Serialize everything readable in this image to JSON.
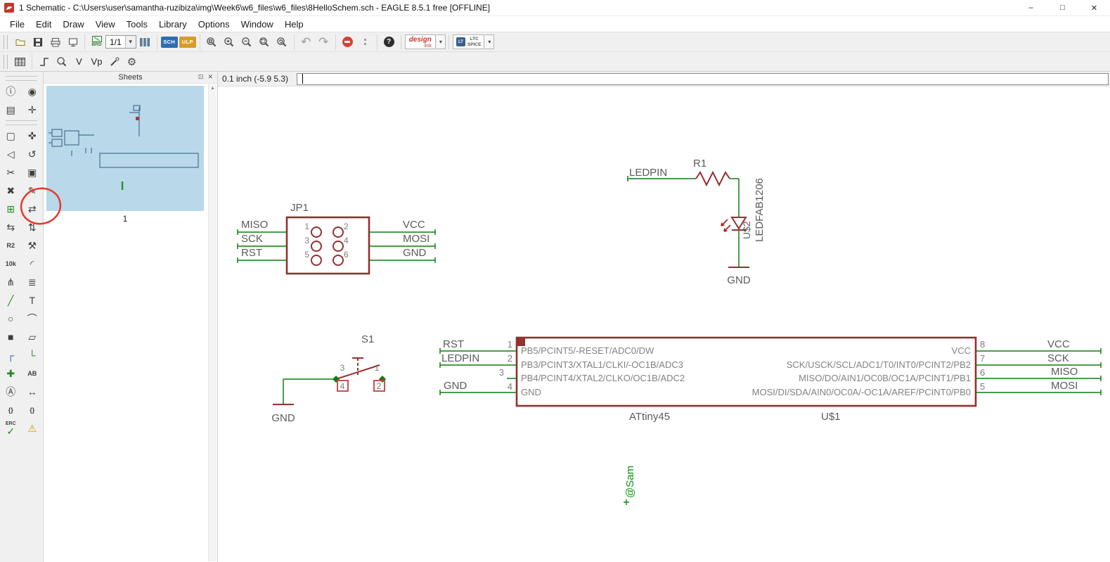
{
  "window": {
    "title": "1 Schematic - C:\\Users\\user\\samantha-ruzibiza\\img\\Week6\\w6_files\\w6_files\\8HelloSchem.sch - EAGLE 8.5.1 free [OFFLINE]",
    "minimize": "–",
    "maximize": "□",
    "close": "✕"
  },
  "menu": {
    "items": [
      "File",
      "Edit",
      "Draw",
      "View",
      "Tools",
      "Library",
      "Options",
      "Window",
      "Help"
    ]
  },
  "toolbar1": {
    "icons": [
      "open",
      "save",
      "print",
      "export-image",
      "switch-to-board",
      "sheet-selector",
      "sheets-list",
      "run-script",
      "run-ulp",
      "zoom-fit",
      "zoom-in",
      "zoom-out",
      "zoom-select",
      "zoom-redraw",
      "undo",
      "redo",
      "stop",
      "command-menu",
      "help",
      "design-link",
      "ltc-spice"
    ],
    "sheet_selector": "1/1",
    "brd_label": "BRD",
    "sch_label": "SCH",
    "ulp_label": "ULP",
    "undo_glyph": "↶",
    "redo_glyph": "↷",
    "help_glyph": "?",
    "dropdown_arrow": "▾",
    "design_link_line1": "design",
    "design_link_line2": "link",
    "ltc_line1": "LTC",
    "ltc_line2": "SPICE",
    "ltc_logo": "LT"
  },
  "toolbar2": {
    "icons": [
      "grid",
      "wire-bend",
      "zoom",
      "voltage-probe",
      "phase-probe",
      "probe",
      "spice-settings"
    ],
    "v_label": "V",
    "vp_label": "Vp",
    "gear_glyph": "⚙"
  },
  "sheets_panel": {
    "title": "Sheets",
    "sheet_number": "1",
    "float_button": "⊡",
    "close_button": "✕",
    "scroll_up": "▲"
  },
  "statusbar": {
    "coordinates": "0.1 inch (-5.9 5.3)"
  },
  "palette": {
    "tools": [
      {
        "name": "info",
        "glyph": "ⓘ"
      },
      {
        "name": "show",
        "glyph": "◉"
      },
      {
        "name": "display-layers",
        "glyph": "▤"
      },
      {
        "name": "mark",
        "glyph": "✛"
      },
      {
        "name": "group",
        "glyph": "▢"
      },
      {
        "name": "move",
        "glyph": "✜"
      },
      {
        "name": "mirror",
        "glyph": "◁"
      },
      {
        "name": "rotate",
        "glyph": "↺"
      },
      {
        "name": "cut",
        "glyph": "✂"
      },
      {
        "name": "copy",
        "glyph": "▣"
      },
      {
        "name": "delete",
        "glyph": "✖"
      },
      {
        "name": "change",
        "glyph": "✎"
      },
      {
        "name": "add-part",
        "glyph": "⊞",
        "cls": "g-green"
      },
      {
        "name": "pinswap",
        "glyph": "⇄"
      },
      {
        "name": "replace",
        "glyph": "⇆"
      },
      {
        "name": "gateswap",
        "glyph": "⇅"
      },
      {
        "name": "name",
        "glyph": "R2",
        "cls": "g-tiny"
      },
      {
        "name": "smash",
        "glyph": "⚒"
      },
      {
        "name": "value",
        "glyph": "10k",
        "cls": "g-tiny"
      },
      {
        "name": "miter",
        "glyph": "◜"
      },
      {
        "name": "split",
        "glyph": "⋔"
      },
      {
        "name": "invoke",
        "glyph": "≣"
      },
      {
        "name": "wire",
        "glyph": "╱",
        "cls": "g-green"
      },
      {
        "name": "text",
        "glyph": "T"
      },
      {
        "name": "circle",
        "glyph": "○"
      },
      {
        "name": "arc",
        "glyph": "⌒"
      },
      {
        "name": "rect",
        "glyph": "■"
      },
      {
        "name": "polygon",
        "glyph": "▱"
      },
      {
        "name": "bus",
        "glyph": "┌",
        "cls": "g-blue"
      },
      {
        "name": "net",
        "glyph": "└",
        "cls": "g-green"
      },
      {
        "name": "junction",
        "glyph": "✚",
        "cls": "g-green"
      },
      {
        "name": "label",
        "glyph": "AB",
        "cls": "g-tiny"
      },
      {
        "name": "attribute",
        "glyph": "Ⓐ"
      },
      {
        "name": "dimension",
        "glyph": "↔"
      },
      {
        "name": "attributes",
        "glyph": "{}",
        "cls": "g-tiny"
      },
      {
        "name": "global-attributes",
        "glyph": "{}",
        "cls": "g-tiny"
      },
      {
        "name": "erc",
        "glyph": "✓",
        "cls": "g-green",
        "top": "ERC"
      },
      {
        "name": "errors",
        "glyph": "⚠",
        "cls": "g-amber"
      }
    ]
  },
  "schematic": {
    "jp1": {
      "ref": "JP1",
      "pins": {
        "p1": "1",
        "p2": "2",
        "p3": "3",
        "p4": "4",
        "p5": "5",
        "p6": "6"
      },
      "nets": {
        "miso": "MISO",
        "sck": "SCK",
        "rst": "RST",
        "vcc": "VCC",
        "mosi": "MOSI",
        "gnd": "GND"
      }
    },
    "r1": {
      "ref": "R1",
      "net": "LEDPIN"
    },
    "led": {
      "ref": "U$2",
      "value": "LEDFAB1206",
      "gnd": "GND"
    },
    "s1": {
      "ref": "S1",
      "pins": {
        "p1": "1",
        "p2": "2",
        "p3": "3",
        "p4": "4"
      },
      "gnd": "GND"
    },
    "ic": {
      "ref": "U$1",
      "value": "ATtiny45",
      "left_pin_numbers": {
        "p1": "1",
        "p2": "2",
        "p3": "3",
        "p4": "4"
      },
      "right_pin_numbers": {
        "p8": "8",
        "p7": "7",
        "p6": "6",
        "p5": "5"
      },
      "left_pin_names": {
        "r1": "PB5/PCINT5/-RESET/ADC0/DW",
        "r2": "PB3/PCINT3/XTAL1/CLKI/-OC1B/ADC3",
        "r3": "PB4/PCINT4/XTAL2/CLKO/OC1B/ADC2",
        "r4": "GND"
      },
      "right_pin_names": {
        "r1": "VCC",
        "r2": "SCK/USCK/SCL/ADC1/T0/INT0/PCINT2/PB2",
        "r3": "MISO/DO/AIN1/OC0B/OC1A/PCINT1/PB1",
        "r4": "MOSI/DI/SDA/AIN0/OC0A/-OC1A/AREF/PCINT0/PB0"
      },
      "left_nets": {
        "rst": "RST",
        "ledpin": "LEDPIN",
        "gnd": "GND"
      },
      "right_nets": {
        "vcc": "VCC",
        "sck": "SCK",
        "miso": "MISO",
        "mosi": "MOSI"
      }
    },
    "annotation": "@Sam"
  }
}
